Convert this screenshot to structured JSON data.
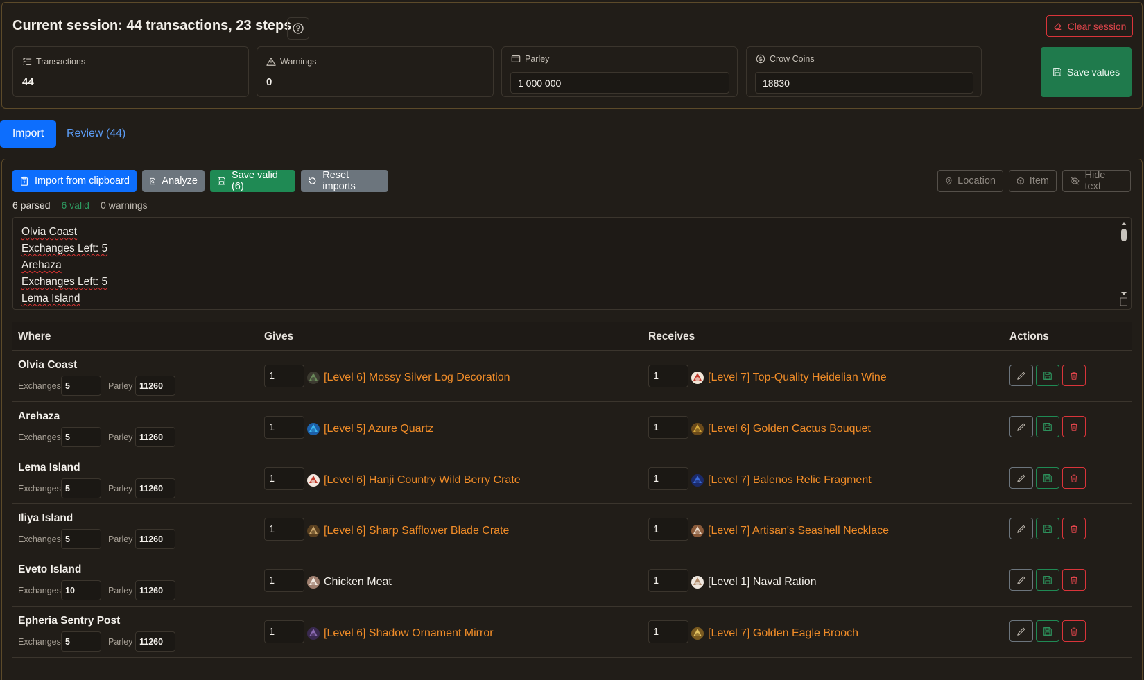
{
  "session": {
    "title": "Current session: 44 transactions, 23 steps",
    "clear_label": "Clear session",
    "save_label": "Save values",
    "cards": {
      "transactions": {
        "label": "Transactions",
        "value": "44"
      },
      "warnings": {
        "label": "Warnings",
        "value": "0"
      },
      "parley": {
        "label": "Parley",
        "value": "1 000 000"
      },
      "crow": {
        "label": "Crow Coins",
        "value": "18830"
      }
    }
  },
  "tabs": {
    "import": "Import",
    "review": "Review (44)"
  },
  "toolbar": {
    "import_clipboard": "Import from clipboard",
    "analyze": "Analyze",
    "save_valid": "Save valid (6)",
    "reset": "Reset imports",
    "location": "Location",
    "item": "Item",
    "hide_text": "Hide text"
  },
  "status": {
    "parsed": "6 parsed",
    "valid": "6 valid",
    "warnings": "0 warnings"
  },
  "textarea": {
    "lines": [
      [
        "Olvia Coast"
      ],
      [
        "Exchanges Left: 5"
      ],
      [
        "Arehaza"
      ],
      [
        "Exchanges Left: 5"
      ],
      [
        "Lema Island"
      ]
    ]
  },
  "table": {
    "headers": {
      "where": "Where",
      "gives": "Gives",
      "receives": "Receives",
      "actions": "Actions"
    },
    "exchanges_label": "Exchanges",
    "parley_label": "Parley",
    "rows": [
      {
        "where": "Olvia Coast",
        "exchanges": "5",
        "parley": "11260",
        "give_qty": "1",
        "give_item": "[Level 6] Mossy Silver Log Decoration",
        "give_icon": "log-decoration-icon",
        "recv_qty": "1",
        "recv_item": "[Level 7] Top-Quality Heidelian Wine",
        "recv_icon": "wine-bottle-icon"
      },
      {
        "where": "Arehaza",
        "exchanges": "5",
        "parley": "11260",
        "give_qty": "1",
        "give_item": "[Level 5] Azure Quartz",
        "give_icon": "quartz-icon",
        "recv_qty": "1",
        "recv_item": "[Level 6] Golden Cactus Bouquet",
        "recv_icon": "cactus-bouquet-icon"
      },
      {
        "where": "Lema Island",
        "exchanges": "5",
        "parley": "11260",
        "give_qty": "1",
        "give_item": "[Level 6] Hanji Country Wild Berry Crate",
        "give_icon": "berry-crate-icon",
        "recv_qty": "1",
        "recv_item": "[Level 7] Balenos Relic Fragment",
        "recv_icon": "relic-fragment-icon"
      },
      {
        "where": "Iliya Island",
        "exchanges": "5",
        "parley": "11260",
        "give_qty": "1",
        "give_item": "[Level 6] Sharp Safflower Blade Crate",
        "give_icon": "blade-crate-icon",
        "recv_qty": "1",
        "recv_item": "[Level 7] Artisan's Seashell Necklace",
        "recv_icon": "seashell-necklace-icon"
      },
      {
        "where": "Eveto Island",
        "exchanges": "10",
        "parley": "11260",
        "give_qty": "1",
        "give_item": "Chicken Meat",
        "give_icon": "chicken-meat-icon",
        "give_white": true,
        "recv_qty": "1",
        "recv_item": "[Level 1] Naval Ration",
        "recv_icon": "naval-ration-icon",
        "recv_white": true
      },
      {
        "where": "Epheria Sentry Post",
        "exchanges": "5",
        "parley": "11260",
        "give_qty": "1",
        "give_item": "[Level 6] Shadow Ornament Mirror",
        "give_icon": "ornament-mirror-icon",
        "recv_qty": "1",
        "recv_item": "[Level 7] Golden Eagle Brooch",
        "recv_icon": "eagle-brooch-icon"
      }
    ]
  },
  "colors": {
    "accent_blue": "#0d6efd",
    "success_green": "#1f7a4c",
    "danger_red": "#d9343a",
    "item_orange": "#f08c28",
    "panel_border": "#5c4a2a"
  }
}
